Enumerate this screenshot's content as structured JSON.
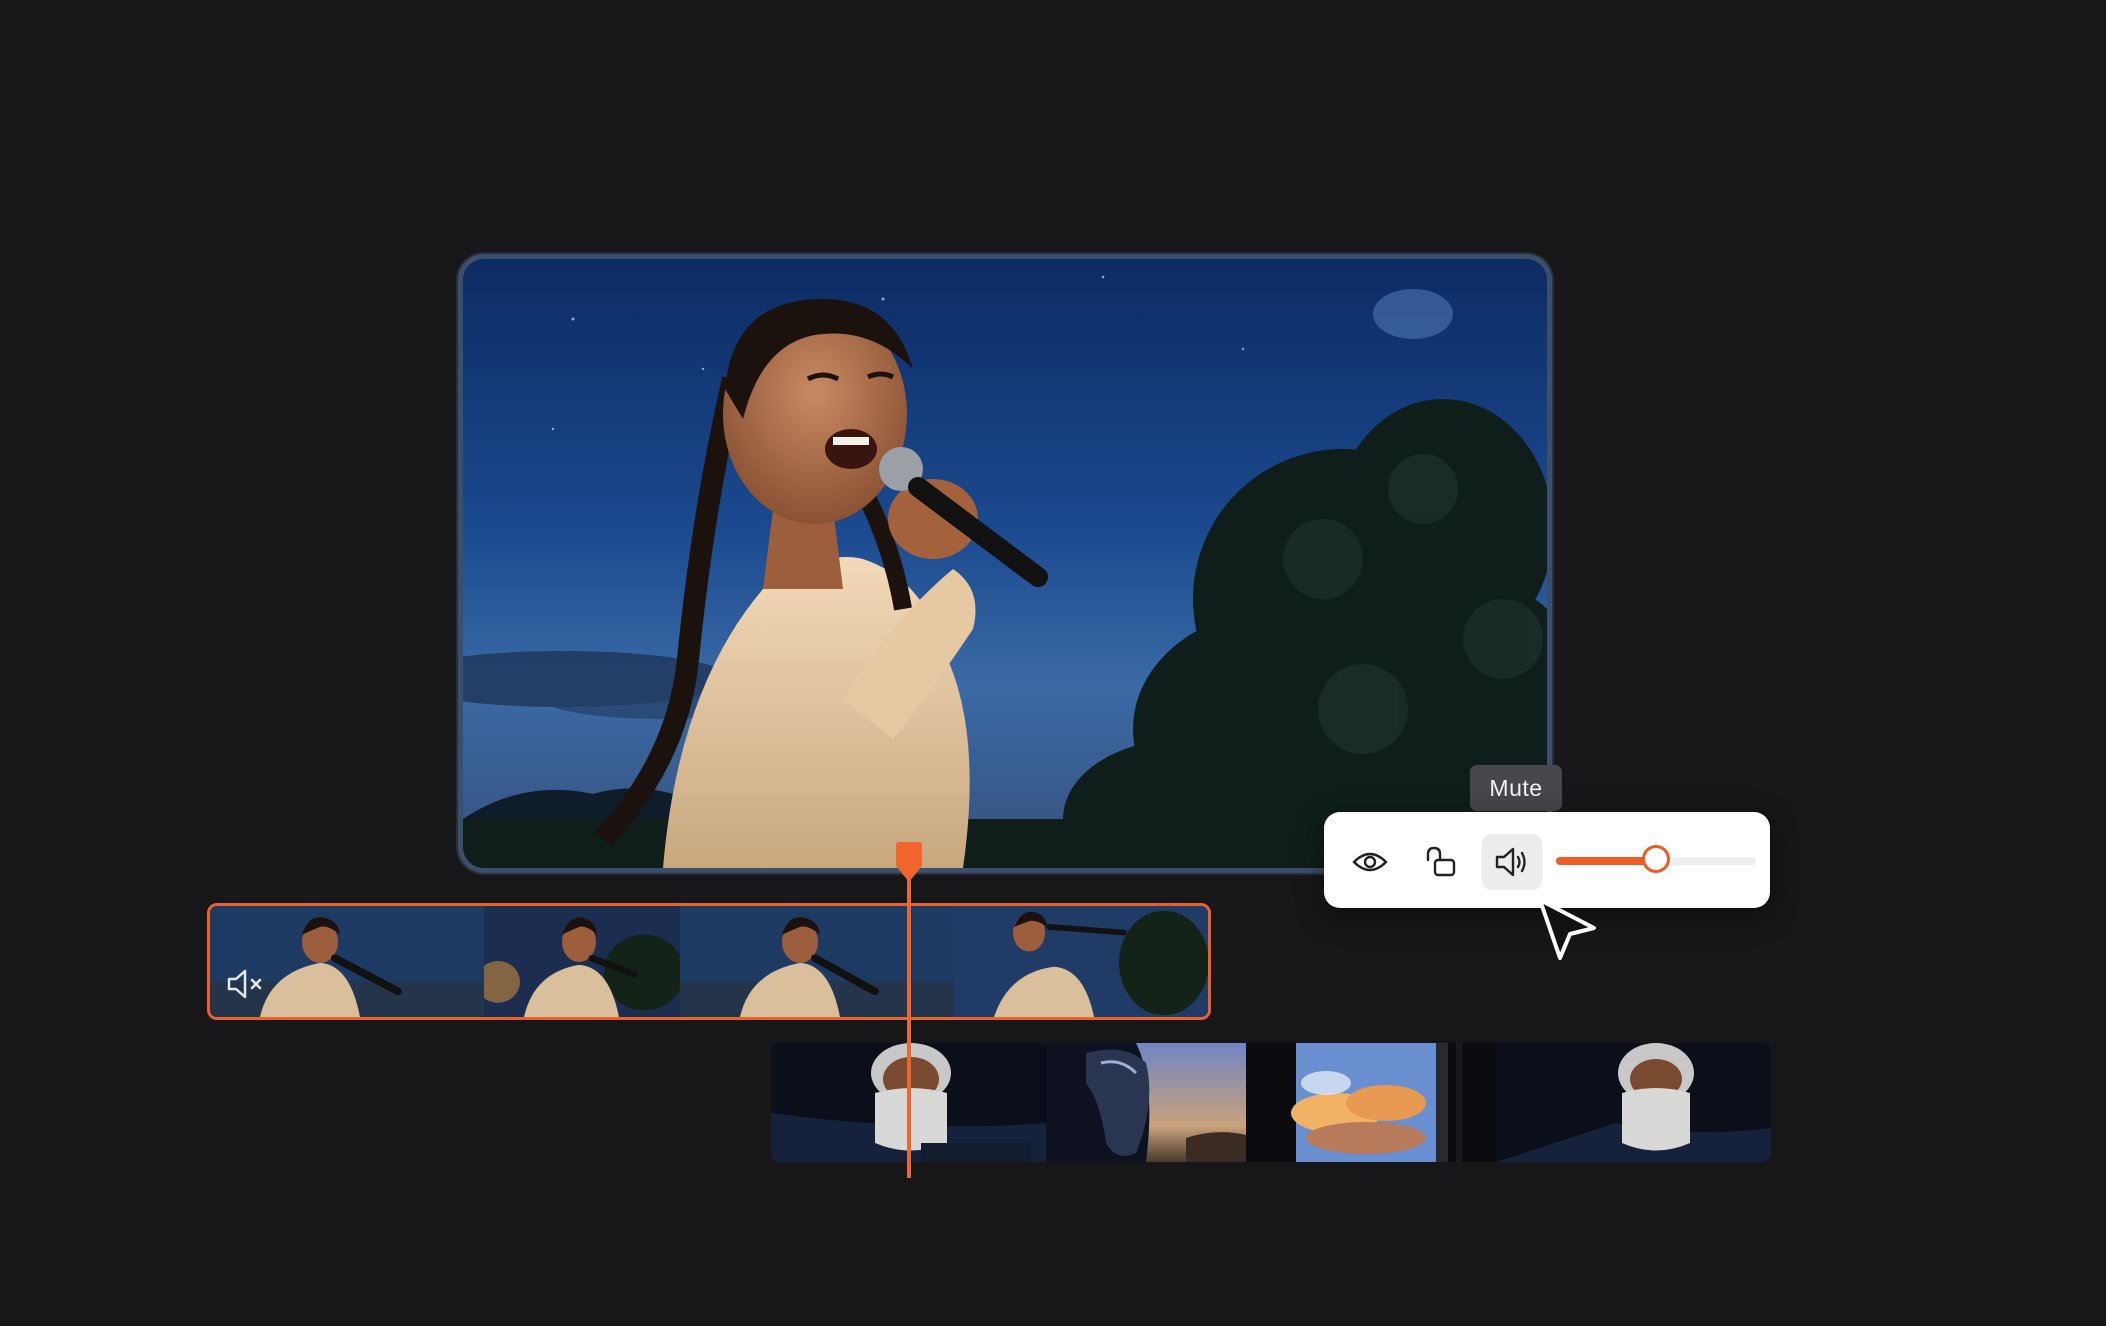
{
  "tooltip": {
    "text": "Mute"
  },
  "controls": {
    "visibility_icon": "eye-icon",
    "lock_icon": "unlock-icon",
    "volume_icon": "speaker-volume-icon",
    "volume_level": 0.5
  },
  "timeline": {
    "main_track": {
      "muted_icon": "speaker-muted-icon",
      "clips": [
        "singer-clip-1",
        "singer-clip-2",
        "singer-clip-3",
        "singer-clip-4"
      ]
    },
    "broll_track": {
      "clips": [
        "masked-woman-clip",
        "horse-clip",
        "sunset-clouds-clip",
        "masked-woman-clip-2"
      ]
    }
  },
  "colors": {
    "accent": "#ee5b25",
    "background": "#17171a",
    "panel": "#ffffff"
  }
}
